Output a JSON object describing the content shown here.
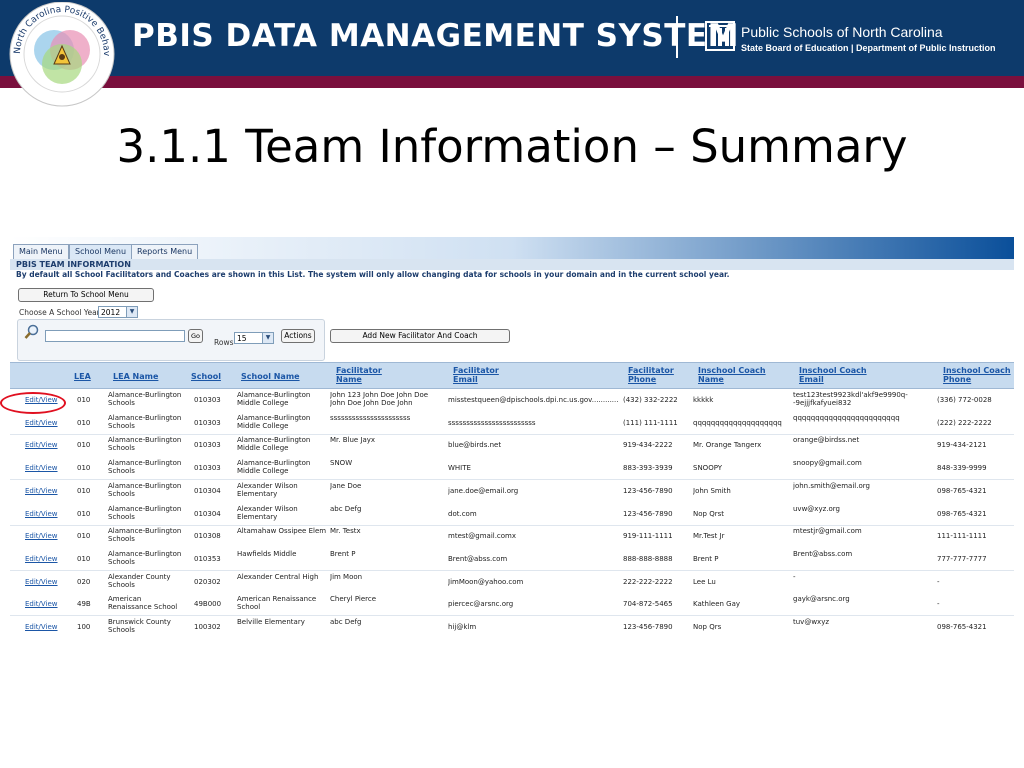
{
  "banner": {
    "title": "PBIS DATA MANAGEMENT SYSTEM",
    "dpi_name": "Public Schools of North Carolina",
    "dpi_sub": "State Board of Education | Department of Public Instruction",
    "logo_text": "North Carolina Positive Behavior Intervention and Support"
  },
  "slide_title": "3.1.1 Team Information – Summary",
  "menu": {
    "tabs": [
      {
        "label": "Main Menu"
      },
      {
        "label": "School Menu"
      },
      {
        "label": "Reports Menu"
      }
    ]
  },
  "section": {
    "heading": "PBIS TEAM INFORMATION",
    "note": "By default all School Facilitators and Coaches are shown in this List. The system will only allow changing data for schools in your domain and in the current school year."
  },
  "controls": {
    "return_button": "Return To School Menu",
    "school_year_label": "Choose A School Year",
    "school_year_value": "2012",
    "go_button": "Go",
    "rows_label": "Rows",
    "rows_value": "15",
    "actions_button": "Actions",
    "add_button": "Add New Facilitator And Coach"
  },
  "table": {
    "headers": {
      "lea": "LEA",
      "lea_name": "LEA Name",
      "school": "School",
      "school_name": "School Name",
      "fac_name": "Facilitator Name",
      "fac_email": "Facilitator Email",
      "fac_phone": "Facilitator Phone",
      "coach_name": "Inschool Coach Name",
      "coach_email": "Inschool Coach Email",
      "coach_phone": "Inschool Coach Phone"
    },
    "edit_label": "Edit/View",
    "rows": [
      {
        "lea": "010",
        "lea_name": "Alamance-Burlington Schools",
        "school": "010303",
        "school_name": "Alamance-Burlington Middle College",
        "fac_name": "John 123 John Doe John Doe John Doe John Doe John",
        "fac_email": "misstestqueen@dpischools.dpi.nc.us.gov............",
        "fac_phone": "(432) 332-2222",
        "coach_name": "kkkkk",
        "coach_email": "test123test9923kdl'akf9e9990q--9ejjjfkafyuei832",
        "coach_phone": "(336) 772-0028"
      },
      {
        "lea": "010",
        "lea_name": "Alamance-Burlington Schools",
        "school": "010303",
        "school_name": "Alamance-Burlington Middle College",
        "fac_name": "ssssssssssssssssssssss",
        "fac_email": "ssssssssssssssssssssssss",
        "fac_phone": "(111) 111-1111",
        "coach_name": "qqqqqqqqqqqqqqqqqqqq",
        "coach_email": "qqqqqqqqqqqqqqqqqqqqqqqq",
        "coach_phone": "(222) 222-2222"
      },
      {
        "lea": "010",
        "lea_name": "Alamance-Burlington Schools",
        "school": "010303",
        "school_name": "Alamance-Burlington Middle College",
        "fac_name": "Mr. Blue Jayx",
        "fac_email": "blue@birds.net",
        "fac_phone": "919-434-2222",
        "coach_name": "Mr. Orange Tangerx",
        "coach_email": "orange@birdss.net",
        "coach_phone": "919-434-2121"
      },
      {
        "lea": "010",
        "lea_name": "Alamance-Burlington Schools",
        "school": "010303",
        "school_name": "Alamance-Burlington Middle College",
        "fac_name": "SNOW",
        "fac_email": "WHITE",
        "fac_phone": "883-393-3939",
        "coach_name": "SNOOPY",
        "coach_email": "snoopy@gmail.com",
        "coach_phone": "848-339-9999"
      },
      {
        "lea": "010",
        "lea_name": "Alamance-Burlington Schools",
        "school": "010304",
        "school_name": "Alexander Wilson Elementary",
        "fac_name": "Jane Doe",
        "fac_email": "jane.doe@email.org",
        "fac_phone": "123-456-7890",
        "coach_name": "John Smith",
        "coach_email": "john.smith@email.org",
        "coach_phone": "098-765-4321"
      },
      {
        "lea": "010",
        "lea_name": "Alamance-Burlington Schools",
        "school": "010304",
        "school_name": "Alexander Wilson Elementary",
        "fac_name": "abc Defg",
        "fac_email": "dot.com",
        "fac_phone": "123-456-7890",
        "coach_name": "Nop Qrst",
        "coach_email": "uvw@xyz.org",
        "coach_phone": "098-765-4321"
      },
      {
        "lea": "010",
        "lea_name": "Alamance-Burlington Schools",
        "school": "010308",
        "school_name": "Altamahaw Ossipee Elem",
        "fac_name": "Mr. Testx",
        "fac_email": "mtest@gmail.comx",
        "fac_phone": "919-111-1111",
        "coach_name": "Mr.Test Jr",
        "coach_email": "mtestjr@gmail.com",
        "coach_phone": "111-111-1111"
      },
      {
        "lea": "010",
        "lea_name": "Alamance-Burlington Schools",
        "school": "010353",
        "school_name": "Hawfields Middle",
        "fac_name": "Brent P",
        "fac_email": "Brent@abss.com",
        "fac_phone": "888-888-8888",
        "coach_name": "Brent P",
        "coach_email": "Brent@abss.com",
        "coach_phone": "777-777-7777"
      },
      {
        "lea": "020",
        "lea_name": "Alexander County Schools",
        "school": "020302",
        "school_name": "Alexander Central High",
        "fac_name": "Jim Moon",
        "fac_email": "JimMoon@yahoo.com",
        "fac_phone": "222-222-2222",
        "coach_name": "Lee Lu",
        "coach_email": "-",
        "coach_phone": "-"
      },
      {
        "lea": "49B",
        "lea_name": "American Renaissance School",
        "school": "49B000",
        "school_name": "American Renaissance School",
        "fac_name": "Cheryl Pierce",
        "fac_email": "piercec@arsnc.org",
        "fac_phone": "704-872-5465",
        "coach_name": "Kathleen Gay",
        "coach_email": "gayk@arsnc.org",
        "coach_phone": "-"
      },
      {
        "lea": "100",
        "lea_name": "Brunswick County Schools",
        "school": "100302",
        "school_name": "Belville Elementary",
        "fac_name": "abc Defg",
        "fac_email": "hij@klm",
        "fac_phone": "123-456-7890",
        "coach_name": "Nop Qrs",
        "coach_email": "tuv@wxyz",
        "coach_phone": "098-765-4321"
      }
    ]
  }
}
